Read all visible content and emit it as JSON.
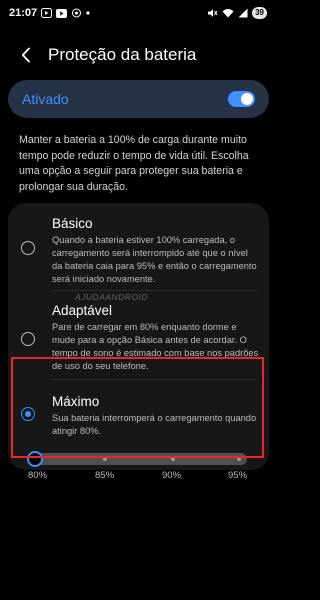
{
  "status_bar": {
    "time": "21:07",
    "battery": "39",
    "icons_left": [
      "video-app-icon",
      "youtube-icon",
      "media-icon",
      "dot-icon"
    ],
    "icons_right": [
      "mute-icon",
      "wifi-icon",
      "signal-icon"
    ]
  },
  "header": {
    "title": "Proteção da bateria"
  },
  "master_toggle": {
    "label": "Ativado",
    "on": true
  },
  "description": "Manter a bateria a 100% de carga durante muito tempo pode reduzir o tempo de vida útil. Escolha uma opção a seguir para proteger sua bateria e prolongar sua duração.",
  "options": [
    {
      "title": "Básico",
      "text": "Quando a bateria estiver 100% carregada, o carregamento será interrompido até que o nível da bateria caia para 95% e então o carregamento será iniciado novamente.",
      "selected": false
    },
    {
      "title": "Adaptável",
      "text": "Pare de carregar em 80% enquanto dorme e mude para a opção Básica antes de acordar. O tempo de sono é estimado com base nos padrões de uso do seu telefone.",
      "selected": false
    },
    {
      "title": "Máximo",
      "text": "Sua bateria interromperá o carregamento quando atingir 80%.",
      "selected": true
    }
  ],
  "limit_slider": {
    "labels": [
      "80%",
      "85%",
      "90%",
      "95%"
    ],
    "value": "80%"
  },
  "watermark": "AJUDAANDROID",
  "colors": {
    "accent": "#3e91ff",
    "highlight": "#e8262b",
    "toggle_card": "#263245"
  }
}
